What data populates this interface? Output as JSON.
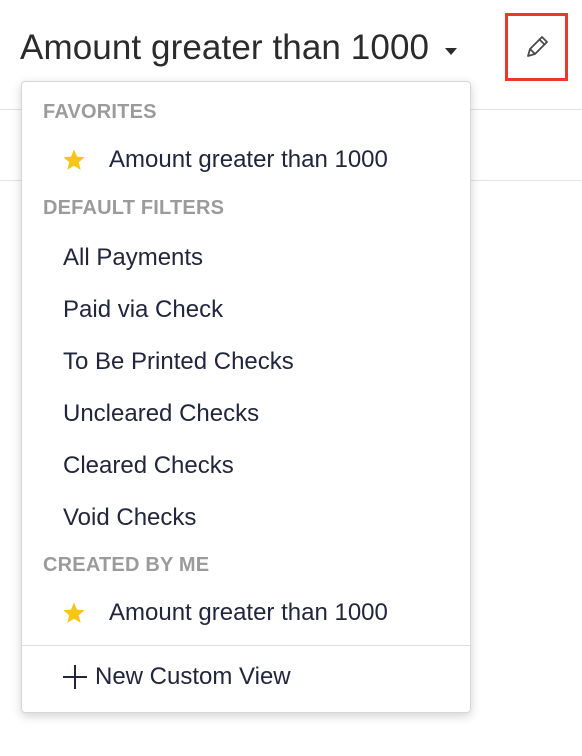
{
  "header": {
    "current_view": "Amount greater than 1000",
    "icons": {
      "dropdown": "chevron-down-icon",
      "edit": "pencil-icon"
    }
  },
  "colors": {
    "highlight_border": "#e8392a",
    "star": "#f5c518",
    "section_title": "#9b9b9b",
    "text": "#21263c"
  },
  "menu": {
    "favorites": {
      "title": "FAVORITES",
      "items": [
        {
          "label": "Amount greater than 1000",
          "icon": "star-icon"
        }
      ]
    },
    "default_filters": {
      "title": "DEFAULT FILTERS",
      "items": [
        {
          "label": "All Payments"
        },
        {
          "label": "Paid via Check"
        },
        {
          "label": "To Be Printed Checks"
        },
        {
          "label": "Uncleared Checks"
        },
        {
          "label": "Cleared Checks"
        },
        {
          "label": "Void Checks"
        }
      ]
    },
    "created_by_me": {
      "title": "CREATED BY ME",
      "items": [
        {
          "label": "Amount greater than 1000",
          "icon": "star-icon"
        }
      ]
    },
    "new_custom_view": {
      "label": "New Custom View",
      "icon": "plus-icon"
    }
  }
}
